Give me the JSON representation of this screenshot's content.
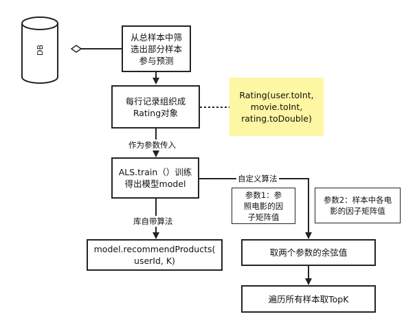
{
  "db": {
    "label": "DB"
  },
  "nodes": {
    "filter": "从总样本中筛\n选出部分样本\n参与预测",
    "rating": "每行记录组织成\nRating对象",
    "als": "ALS.train（）训练\n得出模型model",
    "recommend": "model.recommendProducts(\nuserId, K)",
    "param1": "参数1：参\n照电影的因\n子矩阵值",
    "param2": "参数2：样本中各电\n影的因子矩阵值",
    "cosine": "取两个参数的余弦值",
    "topk": "遍历所有样本取TopK"
  },
  "note": "Rating(user.toInt,\nmovie.toInt,\nrating.toDouble)",
  "edge_labels": {
    "pass_as_params": "作为参数传入",
    "custom_algo": "自定义算法",
    "builtin_algo": "库自带算法"
  }
}
